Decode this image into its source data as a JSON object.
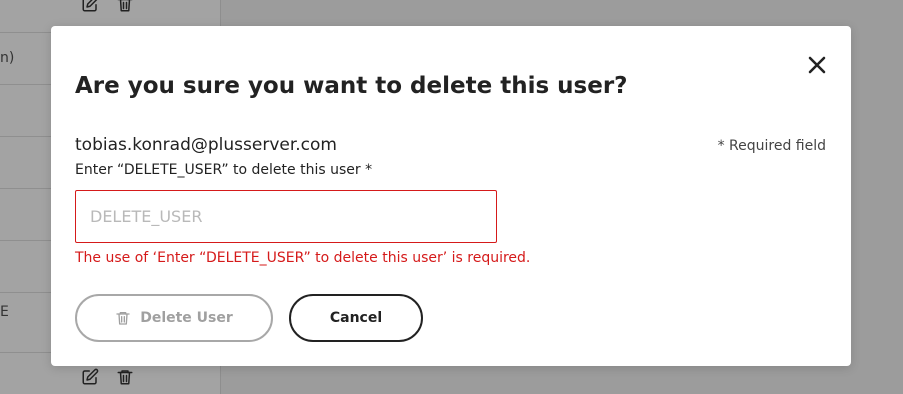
{
  "background": {
    "row_texts": [
      "n)",
      "E"
    ],
    "icons": [
      "edit-icon",
      "trash-icon"
    ]
  },
  "dialog": {
    "title": "Are you sure you want to delete this user?",
    "email": "tobias.konrad@plusserver.com",
    "required_note": "* Required field",
    "confirm_label": "Enter “DELETE_USER” to delete this user *",
    "confirm_placeholder": "DELETE_USER",
    "confirm_value": "",
    "error_message": "The use of ‘Enter “DELETE_USER” to delete this user’ is required.",
    "delete_button_label": "Delete User",
    "cancel_button_label": "Cancel",
    "close_icon": "close-icon",
    "delete_icon": "trash-icon"
  },
  "colors": {
    "error": "#d51a1a",
    "overlay": "#9c9c9c",
    "disabled": "#a8a8a8",
    "text": "#222222"
  }
}
